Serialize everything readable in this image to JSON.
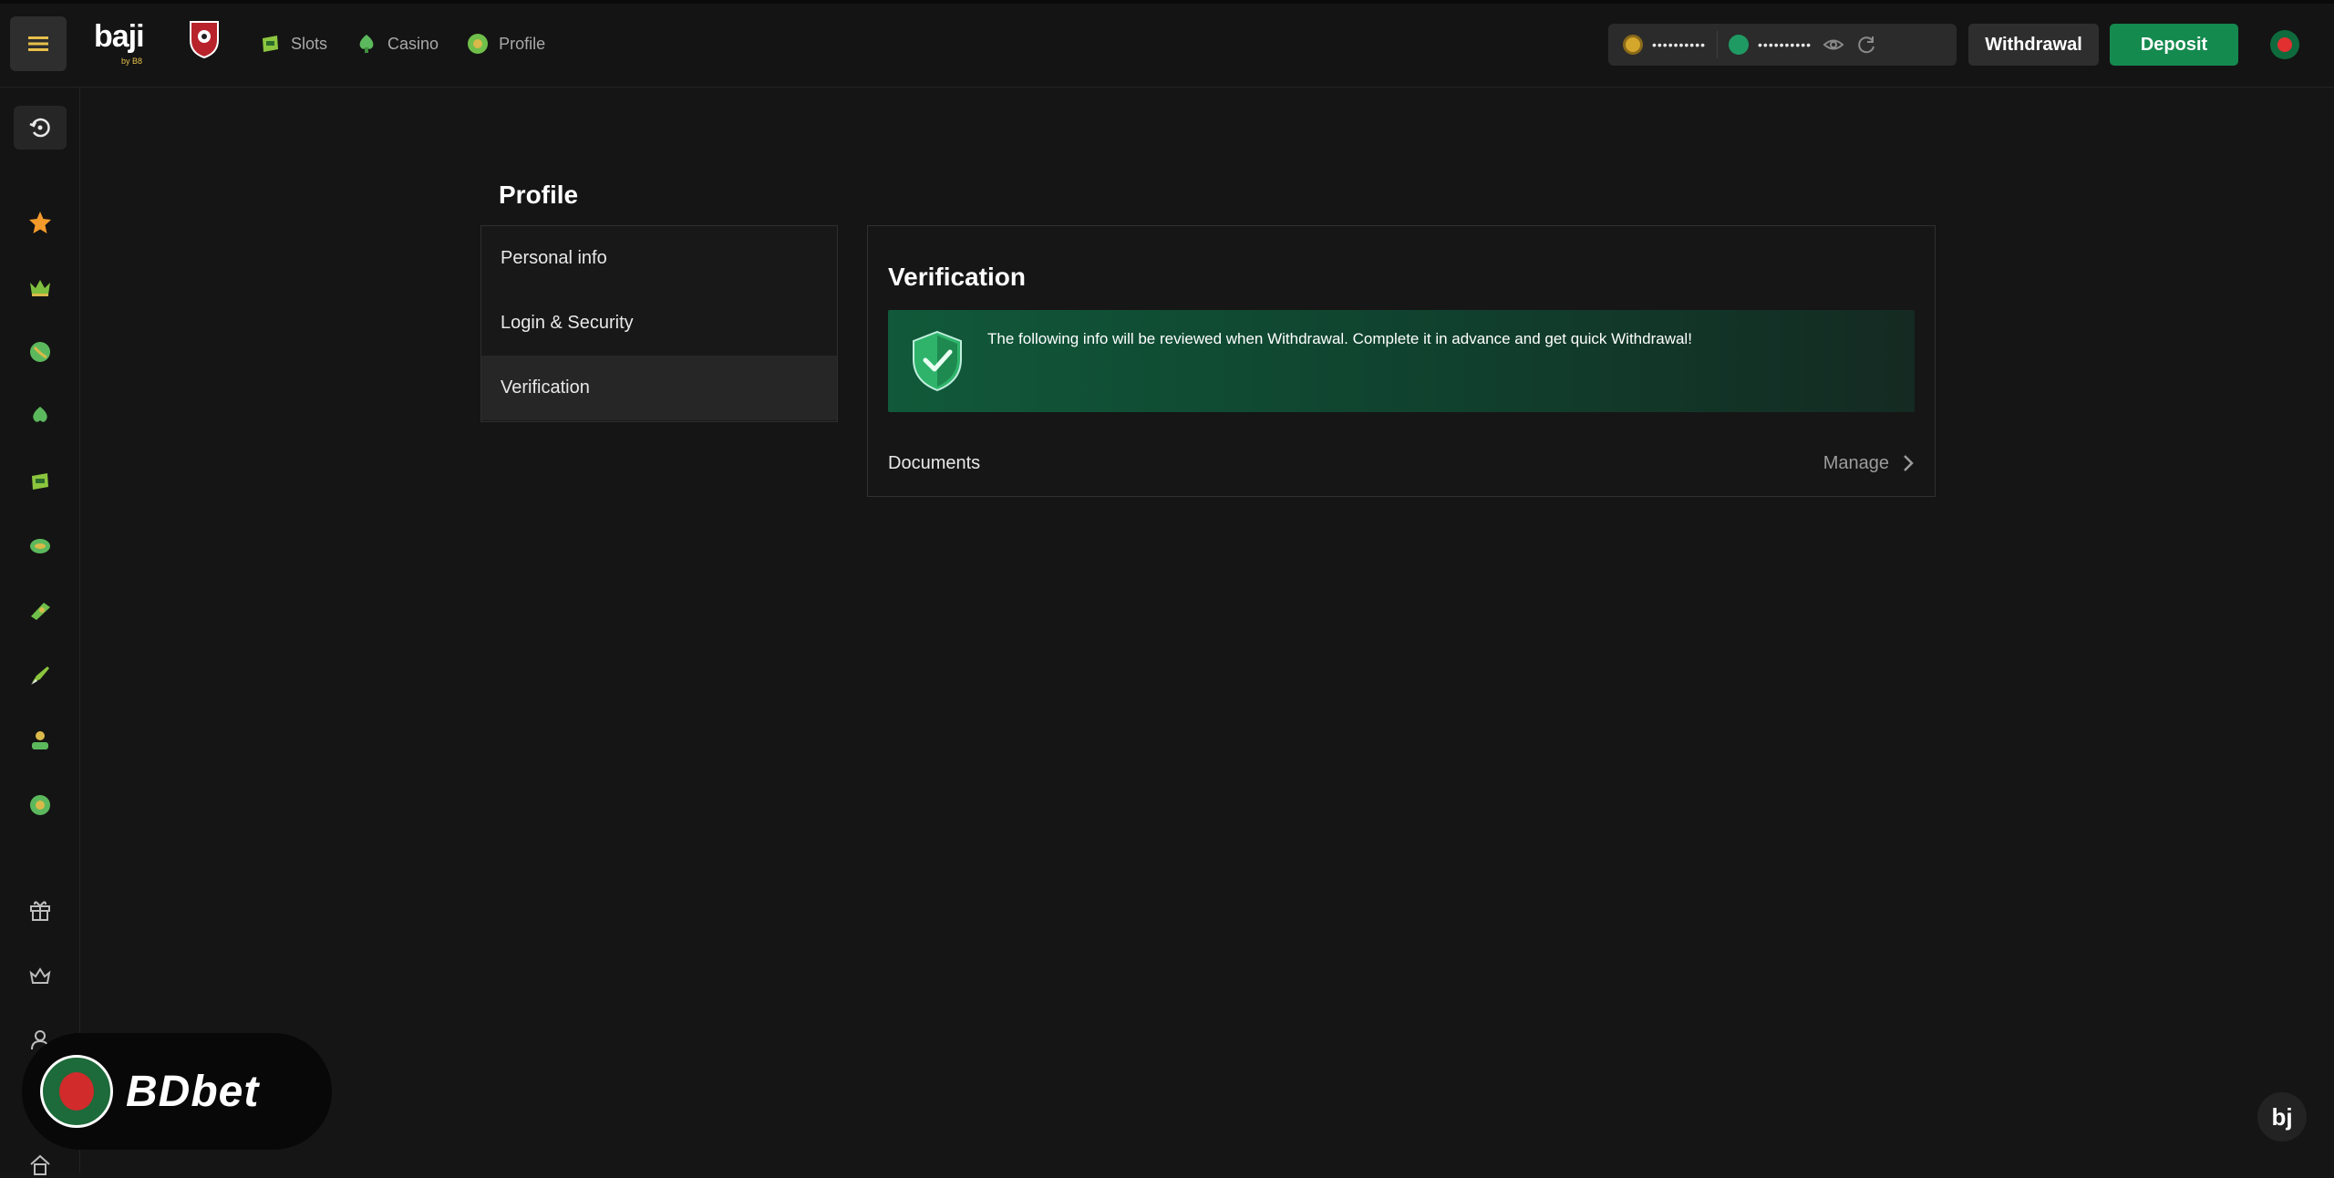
{
  "header": {
    "logo_text": "baji",
    "logo_sub": "by B8",
    "nav": [
      {
        "label": "Slots",
        "icon": "slots-icon"
      },
      {
        "label": "Casino",
        "icon": "casino-icon"
      },
      {
        "label": "Profile",
        "icon": "profile-icon"
      }
    ],
    "balance_main": "••••••••••",
    "balance_secondary": "••••••••••",
    "withdrawal_label": "Withdrawal",
    "deposit_label": "Deposit"
  },
  "sidebar": {
    "icons": [
      "home-refresh-icon",
      "star-icon",
      "crown-icon",
      "sports-ball-icon",
      "poker-chip-icon",
      "slot-ticket-icon",
      "fishing-icon",
      "table-game-icon",
      "rocket-icon",
      "esports-icon",
      "lottery-ball-icon",
      "gift-icon",
      "vip-crown-icon",
      "referral-icon",
      "house-icon"
    ]
  },
  "profile": {
    "title": "Profile",
    "menu": [
      {
        "label": "Personal info",
        "active": false
      },
      {
        "label": "Login & Security",
        "active": false
      },
      {
        "label": "Verification",
        "active": true
      }
    ]
  },
  "verification": {
    "title": "Verification",
    "banner_text": "The following info will be reviewed when Withdrawal. Complete it in advance and get quick Withdrawal!",
    "documents_label": "Documents",
    "manage_label": "Manage"
  },
  "overlay": {
    "watermark": "BDbet",
    "corner_logo": "bj"
  },
  "colors": {
    "background": "#151515",
    "accent_green": "#158a4f",
    "banner_green": "#11593a"
  }
}
